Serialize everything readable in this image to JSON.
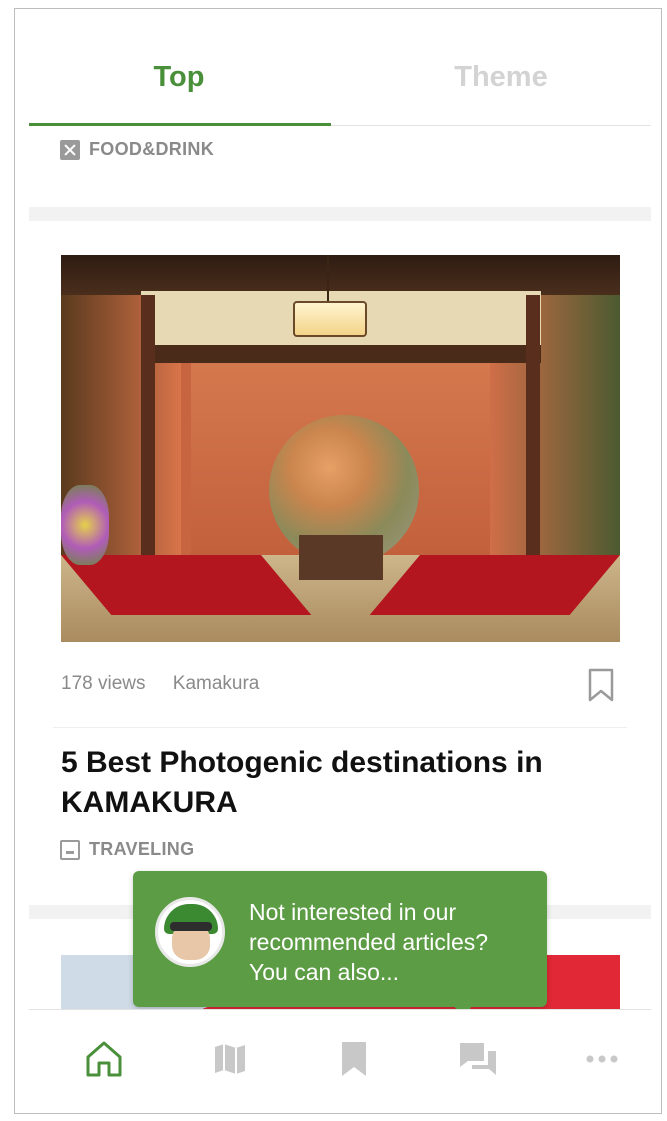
{
  "tabs": [
    {
      "label": "Top",
      "active": true
    },
    {
      "label": "Theme",
      "active": false
    }
  ],
  "colors": {
    "accent": "#4a8f3a",
    "inactive_tab": "#d3d3d3",
    "toast_bg": "#5c9c44"
  },
  "previous_article": {
    "category": "FOOD&DRINK",
    "category_icon": "fork-knife-icon"
  },
  "article": {
    "views": "178 views",
    "location": "Kamakura",
    "title": "5 Best Photogenic destinations in KAMAKURA",
    "category": "TRAVELING",
    "category_icon": "photo-icon",
    "bookmark_icon": "bookmark-outline-icon"
  },
  "toast": {
    "message": "Not interested in our recommended articles? You can also...",
    "avatar_icon": "avatar-icon"
  },
  "bottom_nav": [
    {
      "icon": "home-icon",
      "active": true
    },
    {
      "icon": "map-icon",
      "active": false
    },
    {
      "icon": "bookmark-icon",
      "active": false
    },
    {
      "icon": "chat-icon",
      "active": false
    },
    {
      "icon": "more-icon",
      "active": false
    }
  ]
}
